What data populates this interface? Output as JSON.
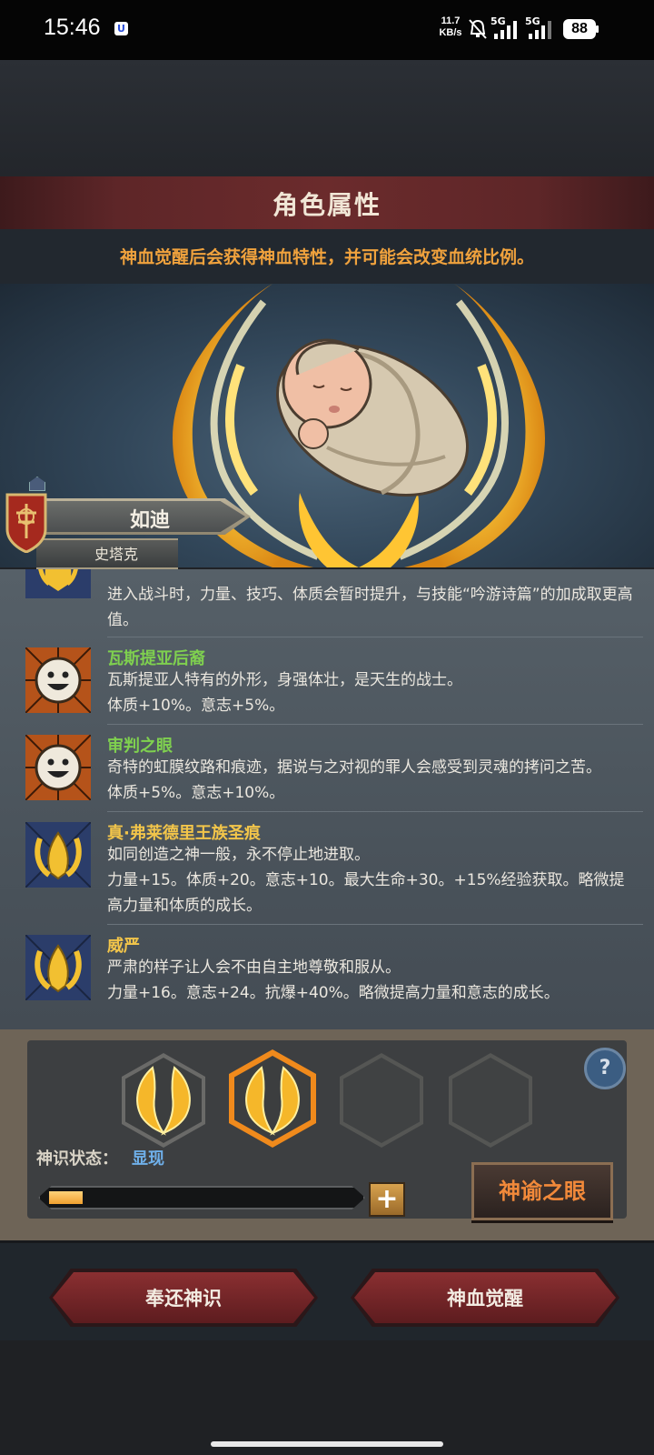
{
  "status_bar": {
    "time": "15:46",
    "app_badge": "U",
    "speed_value": "11.7",
    "speed_unit": "KB/s",
    "network1": "5G",
    "network2": "5G",
    "battery": "88"
  },
  "panel": {
    "title": "角色属性",
    "subtitle": "神血觉醒后会获得神血特性，并可能会改变血统比例。"
  },
  "character": {
    "name": "如迪",
    "house": "史塔克"
  },
  "traits": [
    {
      "name": "",
      "desc": "进入战斗时，力量、技巧、体质会暂时提升，与技能“吟游诗篇”的加成取更高值。",
      "icon": "golden-crest-icon",
      "color": "#c6d36b"
    },
    {
      "name": "瓦斯提亚后裔",
      "desc": "瓦斯提亚人特有的外形，身强体壮，是天生的战士。",
      "stats": "体质+10%。意志+5%。",
      "icon": "smiling-face-icon",
      "color": "#7fd04f"
    },
    {
      "name": "审判之眼",
      "desc": "奇特的虹膜纹路和痕迹，据说与之对视的罪人会感受到灵魂的拷问之苦。",
      "stats": "体质+5%。意志+10%。",
      "icon": "smiling-face-icon",
      "color": "#7fd04f"
    },
    {
      "name": "真·弗莱德里王族圣痕",
      "desc": "如同创造之神一般，永不停止地进取。",
      "stats": "力量+15。体质+20。意志+10。最大生命+30。+15%经验获取。略微提高力量和体质的成长。",
      "icon": "golden-crest-icon",
      "color": "#f2c54a"
    },
    {
      "name": "威严",
      "desc": "严肃的样子让人会不由自主地尊敬和服从。",
      "stats": "力量+16。意志+24。抗爆+40%。略微提高力量和意志的成长。",
      "icon": "golden-crest-icon",
      "color": "#f2c54a"
    }
  ],
  "divine_panel": {
    "state_label": "神识状态：",
    "state_value": "显现",
    "progress": 0.11,
    "help_label": "?",
    "add_label": "+",
    "oracle_button": "神谕之眼",
    "slots": [
      "filled",
      "selected",
      "empty",
      "empty"
    ]
  },
  "actions": {
    "return_button": "奉还神识",
    "awaken_button": "神血觉醒"
  },
  "colors": {
    "accent_orange": "#f0a23d",
    "banner_red": "#6b2b2c",
    "state_blue": "#6fb0ea"
  }
}
